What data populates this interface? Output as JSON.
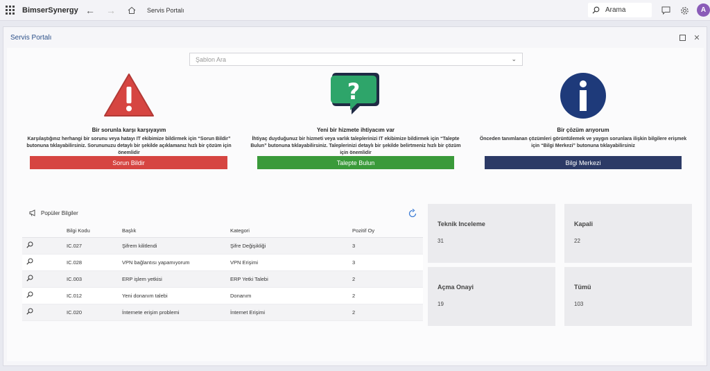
{
  "app": {
    "brand": "BimserSynergy",
    "breadcrumb": "Servis Portalı",
    "avatar_initial": "A"
  },
  "search": {
    "label": "Arama"
  },
  "window": {
    "title": "Servis Portalı"
  },
  "template_search": {
    "placeholder": "Şablon Ara"
  },
  "cards": [
    {
      "title": "Bir sorunla karşı karşıyayım",
      "desc": "Karşılaştığınız herhangi bir sorunu veya hatayı IT ekibimize bildirmek için “Sorun Bildir” butonuna tıklayabilirsiniz. Sorununuzu detaylı bir şekilde açıklamanız hızlı bir çözüm için önemlidir",
      "button": "Sorun Bildir",
      "color": "#d64541"
    },
    {
      "title": "Yeni bir hizmete ihtiyacım var",
      "desc": "İhtiyaç duyduğunuz bir hizmeti veya varlık taleplerinizi IT ekibimize bildirmek için “Talepte Bulun” butonuna tıklayabilirsiniz. Taleplerinizi detaylı bir şekilde belirtmeniz hızlı bir çözüm için önemlidir",
      "button": "Talepte Bulun",
      "color": "#3a9a3a"
    },
    {
      "title": "Bir çözüm arıyorum",
      "desc": "Önceden tanımlanan çözümleri görüntülemek ve yaygın sorunlara ilişkin bilgilere erişmek için “Bilgi Merkezi” butonuna tıklayabilirsiniz",
      "button": "Bilgi Merkezi",
      "color": "#2c3a66"
    }
  ],
  "popular": {
    "title": "Popüler Bilgiler",
    "columns": [
      "Bilgi Kodu",
      "Başlık",
      "Kategori",
      "Pozitif Oy"
    ],
    "rows": [
      {
        "code": "IC.027",
        "title": "Şifrem kilitlendi",
        "category": "Şifre Değişikliği",
        "votes": "3"
      },
      {
        "code": "IC.028",
        "title": "VPN bağlantısı yapamıyorum",
        "category": "VPN Erişimi",
        "votes": "3"
      },
      {
        "code": "IC.003",
        "title": "ERP işlem yetkisi",
        "category": "ERP Yetki Talebi",
        "votes": "2"
      },
      {
        "code": "IC.012",
        "title": "Yeni donanım talebi",
        "category": "Donanım",
        "votes": "2"
      },
      {
        "code": "IC.020",
        "title": "İnternete erişim problemi",
        "category": "İnternet Erişimi",
        "votes": "2"
      }
    ]
  },
  "stats": [
    {
      "title": "Teknik Inceleme",
      "value": "31"
    },
    {
      "title": "Kapali",
      "value": "22"
    },
    {
      "title": "Açma Onayi",
      "value": "19"
    },
    {
      "title": "Tümü",
      "value": "103"
    }
  ]
}
